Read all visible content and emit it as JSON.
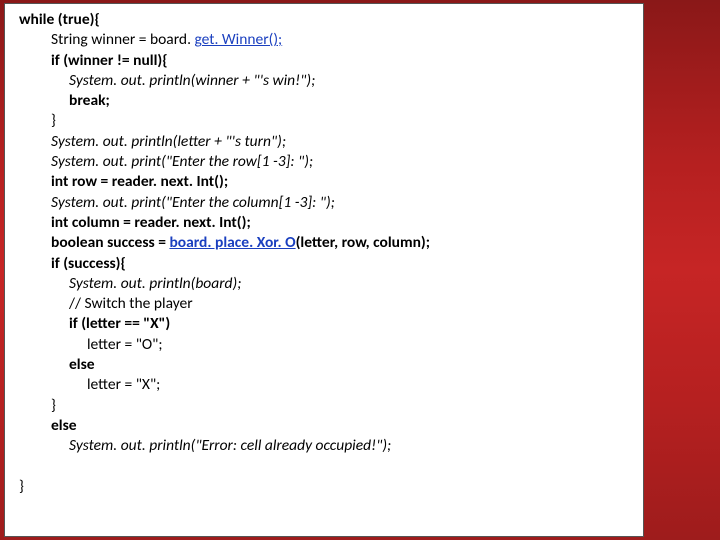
{
  "code": {
    "l1a": "while (true){",
    "l2a": "String winner = board. ",
    "l2b": "get. Winner();",
    "l3a": "if (winner != null){",
    "l4a": "System. ",
    "l4b": "out. println(winner",
    "l4c": " + \"'s win!\");",
    "l5a": "break;",
    "l6a": "}",
    "l7a": "System. ",
    "l7b": "out. println(letter",
    "l7c": " + \"'s turn\");",
    "l8a": "System. ",
    "l8b": "out. print(\"Enter",
    "l8c": " the row[1 -3]: \");",
    "l9a": "int row = reader. next. Int();",
    "l10a": "System. ",
    "l10b": "out. print(\"Enter",
    "l10c": " the column[1 -3]: \");",
    "l11a": "int column = reader. next. Int();",
    "l12a": "boolean success = ",
    "l12b": "board. place. Xor. O",
    "l12c": "(letter, row, column);",
    "l13a": "if (success){",
    "l14a": "System. ",
    "l14b": "out. println(board",
    "l14c": ");",
    "l15a": "// Switch the player",
    "l16a": "if (letter == \"X\")",
    "l17a": "letter = \"O\";",
    "l18a": "else",
    "l19a": "letter = \"X\";",
    "l20a": "}",
    "l21a": "else",
    "l22a": "System. ",
    "l22b": "out. println(\"Error",
    "l22c": ": cell already occupied!\");",
    "l23a": " ",
    "l24a": "}"
  }
}
